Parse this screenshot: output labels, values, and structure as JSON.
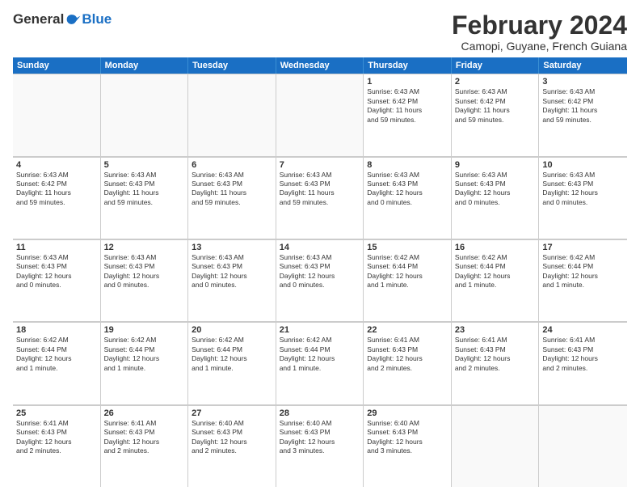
{
  "logo": {
    "general": "General",
    "blue": "Blue"
  },
  "title": {
    "main": "February 2024",
    "sub": "Camopi, Guyane, French Guiana"
  },
  "days": [
    "Sunday",
    "Monday",
    "Tuesday",
    "Wednesday",
    "Thursday",
    "Friday",
    "Saturday"
  ],
  "weeks": [
    [
      {
        "day": "",
        "info": ""
      },
      {
        "day": "",
        "info": ""
      },
      {
        "day": "",
        "info": ""
      },
      {
        "day": "",
        "info": ""
      },
      {
        "day": "1",
        "info": "Sunrise: 6:43 AM\nSunset: 6:42 PM\nDaylight: 11 hours\nand 59 minutes."
      },
      {
        "day": "2",
        "info": "Sunrise: 6:43 AM\nSunset: 6:42 PM\nDaylight: 11 hours\nand 59 minutes."
      },
      {
        "day": "3",
        "info": "Sunrise: 6:43 AM\nSunset: 6:42 PM\nDaylight: 11 hours\nand 59 minutes."
      }
    ],
    [
      {
        "day": "4",
        "info": "Sunrise: 6:43 AM\nSunset: 6:42 PM\nDaylight: 11 hours\nand 59 minutes."
      },
      {
        "day": "5",
        "info": "Sunrise: 6:43 AM\nSunset: 6:43 PM\nDaylight: 11 hours\nand 59 minutes."
      },
      {
        "day": "6",
        "info": "Sunrise: 6:43 AM\nSunset: 6:43 PM\nDaylight: 11 hours\nand 59 minutes."
      },
      {
        "day": "7",
        "info": "Sunrise: 6:43 AM\nSunset: 6:43 PM\nDaylight: 11 hours\nand 59 minutes."
      },
      {
        "day": "8",
        "info": "Sunrise: 6:43 AM\nSunset: 6:43 PM\nDaylight: 12 hours\nand 0 minutes."
      },
      {
        "day": "9",
        "info": "Sunrise: 6:43 AM\nSunset: 6:43 PM\nDaylight: 12 hours\nand 0 minutes."
      },
      {
        "day": "10",
        "info": "Sunrise: 6:43 AM\nSunset: 6:43 PM\nDaylight: 12 hours\nand 0 minutes."
      }
    ],
    [
      {
        "day": "11",
        "info": "Sunrise: 6:43 AM\nSunset: 6:43 PM\nDaylight: 12 hours\nand 0 minutes."
      },
      {
        "day": "12",
        "info": "Sunrise: 6:43 AM\nSunset: 6:43 PM\nDaylight: 12 hours\nand 0 minutes."
      },
      {
        "day": "13",
        "info": "Sunrise: 6:43 AM\nSunset: 6:43 PM\nDaylight: 12 hours\nand 0 minutes."
      },
      {
        "day": "14",
        "info": "Sunrise: 6:43 AM\nSunset: 6:43 PM\nDaylight: 12 hours\nand 0 minutes."
      },
      {
        "day": "15",
        "info": "Sunrise: 6:42 AM\nSunset: 6:44 PM\nDaylight: 12 hours\nand 1 minute."
      },
      {
        "day": "16",
        "info": "Sunrise: 6:42 AM\nSunset: 6:44 PM\nDaylight: 12 hours\nand 1 minute."
      },
      {
        "day": "17",
        "info": "Sunrise: 6:42 AM\nSunset: 6:44 PM\nDaylight: 12 hours\nand 1 minute."
      }
    ],
    [
      {
        "day": "18",
        "info": "Sunrise: 6:42 AM\nSunset: 6:44 PM\nDaylight: 12 hours\nand 1 minute."
      },
      {
        "day": "19",
        "info": "Sunrise: 6:42 AM\nSunset: 6:44 PM\nDaylight: 12 hours\nand 1 minute."
      },
      {
        "day": "20",
        "info": "Sunrise: 6:42 AM\nSunset: 6:44 PM\nDaylight: 12 hours\nand 1 minute."
      },
      {
        "day": "21",
        "info": "Sunrise: 6:42 AM\nSunset: 6:44 PM\nDaylight: 12 hours\nand 1 minute."
      },
      {
        "day": "22",
        "info": "Sunrise: 6:41 AM\nSunset: 6:43 PM\nDaylight: 12 hours\nand 2 minutes."
      },
      {
        "day": "23",
        "info": "Sunrise: 6:41 AM\nSunset: 6:43 PM\nDaylight: 12 hours\nand 2 minutes."
      },
      {
        "day": "24",
        "info": "Sunrise: 6:41 AM\nSunset: 6:43 PM\nDaylight: 12 hours\nand 2 minutes."
      }
    ],
    [
      {
        "day": "25",
        "info": "Sunrise: 6:41 AM\nSunset: 6:43 PM\nDaylight: 12 hours\nand 2 minutes."
      },
      {
        "day": "26",
        "info": "Sunrise: 6:41 AM\nSunset: 6:43 PM\nDaylight: 12 hours\nand 2 minutes."
      },
      {
        "day": "27",
        "info": "Sunrise: 6:40 AM\nSunset: 6:43 PM\nDaylight: 12 hours\nand 2 minutes."
      },
      {
        "day": "28",
        "info": "Sunrise: 6:40 AM\nSunset: 6:43 PM\nDaylight: 12 hours\nand 3 minutes."
      },
      {
        "day": "29",
        "info": "Sunrise: 6:40 AM\nSunset: 6:43 PM\nDaylight: 12 hours\nand 3 minutes."
      },
      {
        "day": "",
        "info": ""
      },
      {
        "day": "",
        "info": ""
      }
    ]
  ]
}
